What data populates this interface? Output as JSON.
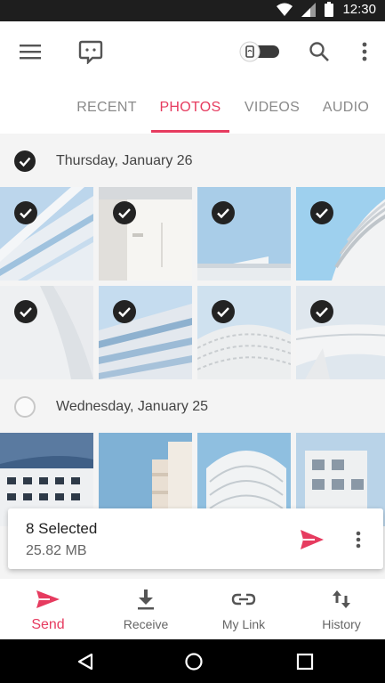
{
  "status_bar": {
    "time": "12:30"
  },
  "app_bar": {
    "icons": [
      "menu-icon",
      "chat-icon",
      "toggle-switch",
      "search-icon",
      "more-vert-icon"
    ]
  },
  "tabs": [
    {
      "label": "RECENT",
      "active": false
    },
    {
      "label": "PHOTOS",
      "active": true
    },
    {
      "label": "VIDEOS",
      "active": false
    },
    {
      "label": "AUDIO",
      "active": false
    }
  ],
  "sections": [
    {
      "title": "Thursday, January 26",
      "checked": true,
      "photos": [
        {
          "selected": true
        },
        {
          "selected": true
        },
        {
          "selected": true
        },
        {
          "selected": true
        },
        {
          "selected": true
        },
        {
          "selected": true
        },
        {
          "selected": true
        },
        {
          "selected": true
        }
      ]
    },
    {
      "title": "Wednesday, January 25",
      "checked": false,
      "photos": [
        {
          "selected": false
        },
        {
          "selected": false
        },
        {
          "selected": false
        },
        {
          "selected": false
        }
      ]
    }
  ],
  "selection_bar": {
    "count": "8 Selected",
    "size": "25.82 MB"
  },
  "bottom_nav": [
    {
      "label": "Send",
      "icon": "send-icon",
      "active": true
    },
    {
      "label": "Receive",
      "icon": "download-icon",
      "active": false
    },
    {
      "label": "My Link",
      "icon": "link-icon",
      "active": false
    },
    {
      "label": "History",
      "icon": "swap-vert-icon",
      "active": false
    }
  ],
  "colors": {
    "accent": "#e63b5f",
    "check": "#232323"
  }
}
